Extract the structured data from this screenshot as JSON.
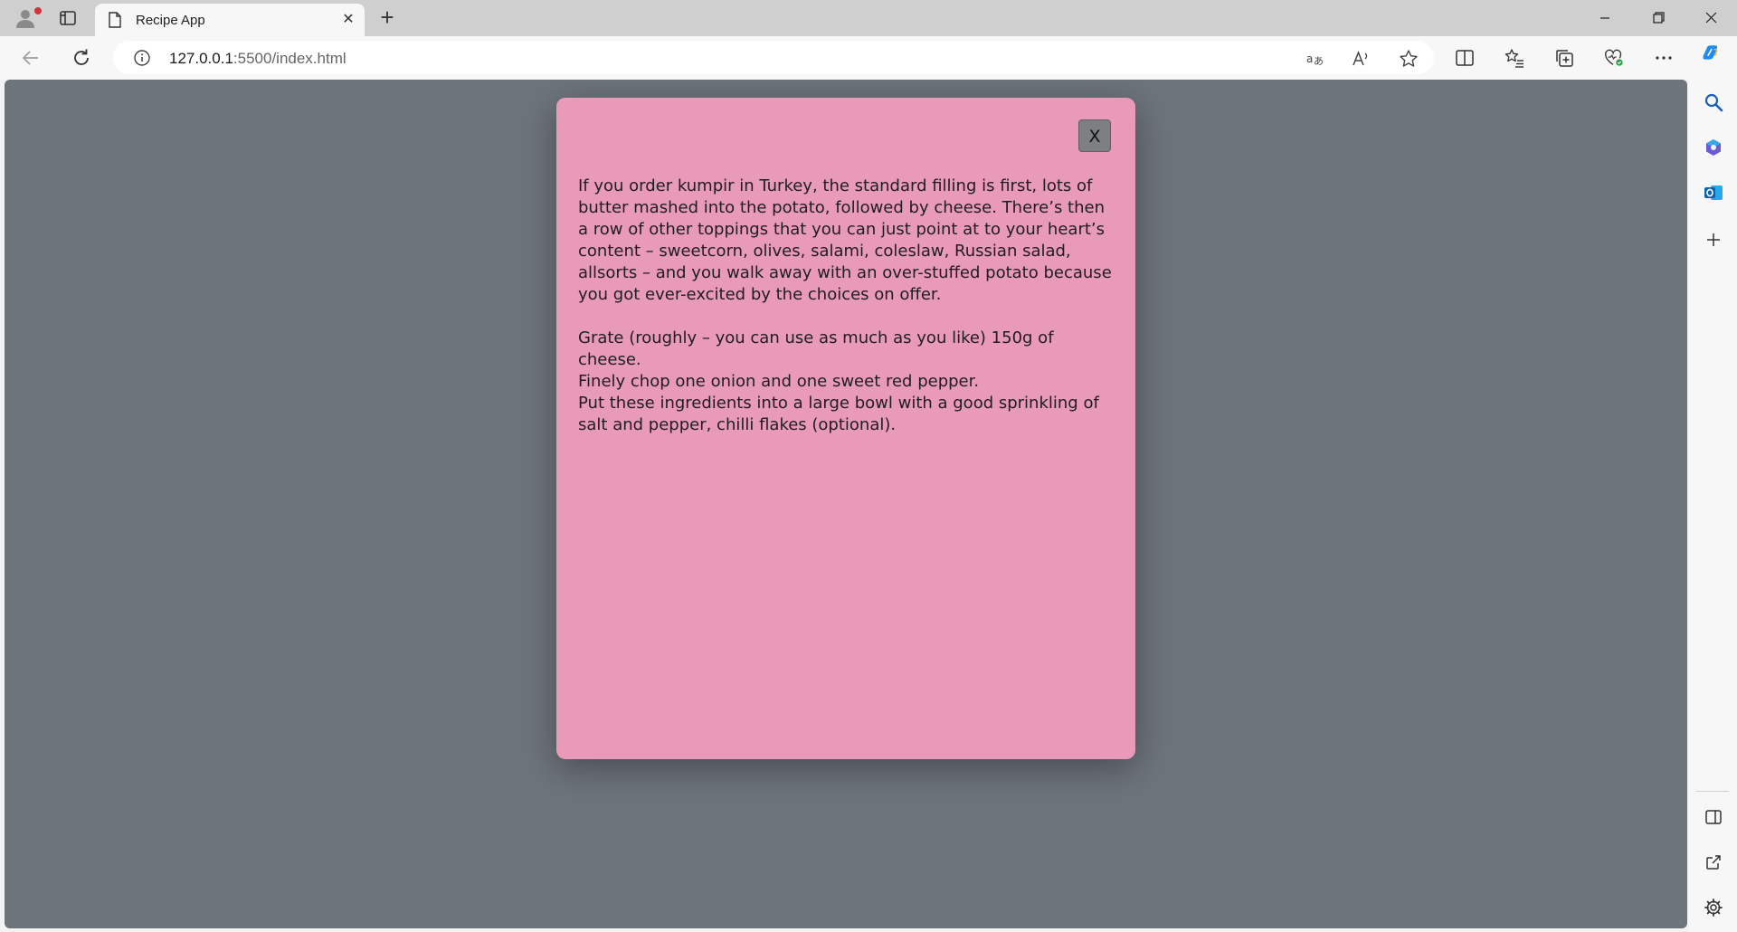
{
  "browser": {
    "tab": {
      "title": "Recipe App",
      "close_label": "✕"
    },
    "new_tab_label": "+",
    "address": {
      "host": "127.0.0.1",
      "rest": ":5500/index.html"
    }
  },
  "modal": {
    "close_label": "X",
    "paragraph_1": "If you order kumpir in Turkey, the standard filling is first, lots of butter mashed into the potato, followed by cheese. There’s then a row of other toppings that you can just point at to your heart’s content – sweetcorn, olives, salami, coleslaw, Russian salad, allsorts – and you walk away with an over-stuffed potato because you got ever-excited by the choices on offer.",
    "steps": [
      "Grate (roughly – you can use as much as you like) 150g of cheese.",
      "Finely chop one onion and one sweet red pepper.",
      "Put these ingredients into a large bowl with a good sprinkling of salt and pepper, chilli flakes (optional)."
    ]
  },
  "colors": {
    "page_background": "#6e747c",
    "modal_background": "#ea9ab9",
    "close_button": "#7d7f82"
  }
}
